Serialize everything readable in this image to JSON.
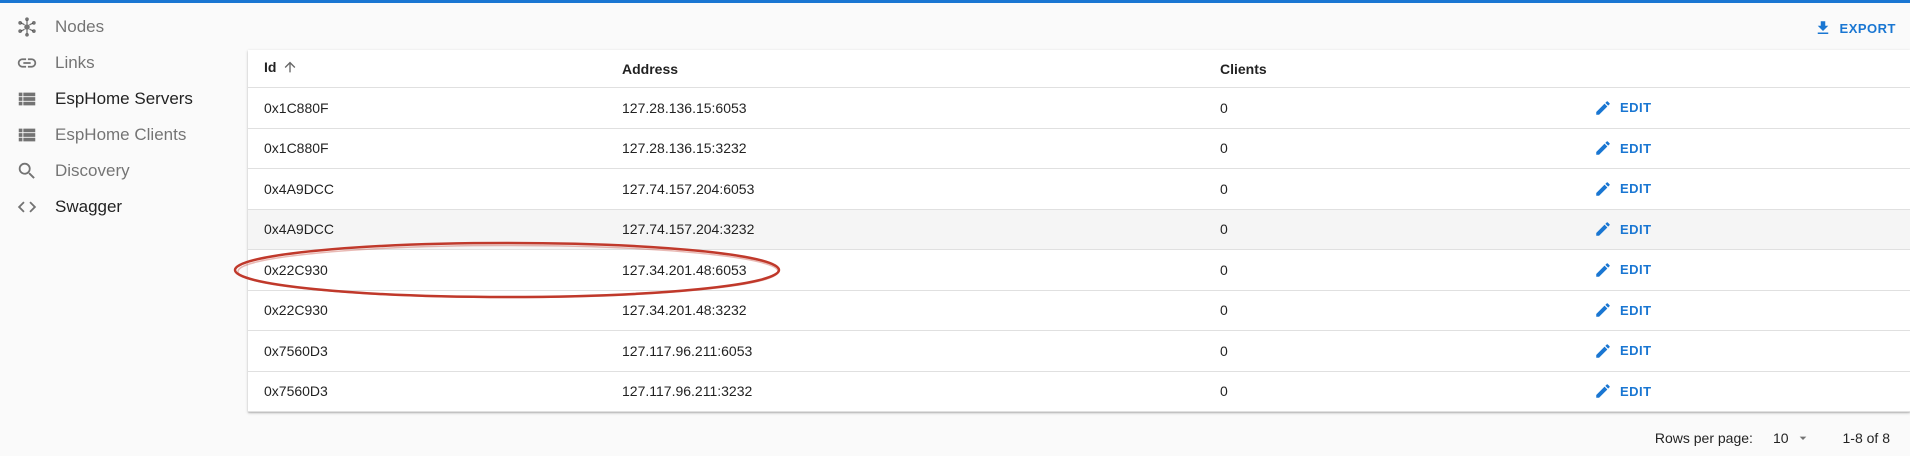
{
  "sidebar": {
    "items": [
      {
        "label": "Nodes",
        "icon": "hub-icon"
      },
      {
        "label": "Links",
        "icon": "link-icon"
      },
      {
        "label": "EspHome Servers",
        "icon": "list-icon"
      },
      {
        "label": "EspHome Clients",
        "icon": "list-icon"
      },
      {
        "label": "Discovery",
        "icon": "search-icon"
      },
      {
        "label": "Swagger",
        "icon": "code-icon"
      }
    ]
  },
  "toolbar": {
    "export_label": "EXPORT"
  },
  "table": {
    "columns": {
      "id": "Id",
      "address": "Address",
      "clients": "Clients"
    },
    "edit_label": "EDIT",
    "rows": [
      {
        "id": "0x1C880F",
        "address": "127.28.136.15:6053",
        "clients": "0"
      },
      {
        "id": "0x1C880F",
        "address": "127.28.136.15:3232",
        "clients": "0"
      },
      {
        "id": "0x4A9DCC",
        "address": "127.74.157.204:6053",
        "clients": "0"
      },
      {
        "id": "0x4A9DCC",
        "address": "127.74.157.204:3232",
        "clients": "0"
      },
      {
        "id": "0x22C930",
        "address": "127.34.201.48:6053",
        "clients": "0"
      },
      {
        "id": "0x22C930",
        "address": "127.34.201.48:3232",
        "clients": "0"
      },
      {
        "id": "0x7560D3",
        "address": "127.117.96.211:6053",
        "clients": "0"
      },
      {
        "id": "0x7560D3",
        "address": "127.117.96.211:3232",
        "clients": "0"
      }
    ]
  },
  "pagination": {
    "rows_per_page_label": "Rows per page:",
    "rows_per_page_value": "10",
    "range_text": "1-8 of 8"
  },
  "colors": {
    "accent": "#1976d2",
    "annotation": "#c0392b"
  }
}
